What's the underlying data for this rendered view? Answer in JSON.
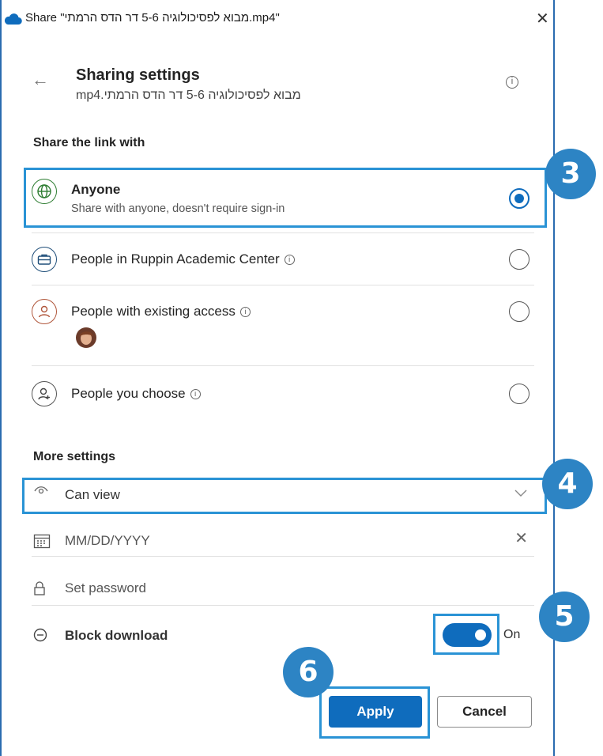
{
  "window": {
    "title": "Share \"מבוא לפסיכולוגיה 5-6 דר הדס הרמתי.mp4\"",
    "close_glyph": "✕",
    "app_icon": "onedrive-cloud-icon"
  },
  "header": {
    "back_glyph": "←",
    "title": "Sharing settings",
    "subtitle": "מבוא לפסיכולוגיה 5-6 דר הדס הרמתי.mp4",
    "info_glyph": "i"
  },
  "share_with": {
    "label": "Share the link with",
    "options": [
      {
        "label": "Anyone",
        "description": "Share with anyone, doesn't require sign-in",
        "icon": "globe-icon",
        "selected": true
      },
      {
        "label": "People in Ruppin Academic Center",
        "icon": "briefcase-icon",
        "selected": false,
        "info": "i"
      },
      {
        "label": "People with existing access",
        "icon": "person-icon",
        "selected": false,
        "info": "i"
      },
      {
        "label": "People you choose",
        "icon": "person-add-icon",
        "selected": false,
        "info": "i"
      }
    ]
  },
  "more_settings": {
    "label": "More settings",
    "permission": {
      "value": "Can view",
      "icon": "eye-icon"
    },
    "expiry": {
      "placeholder": "MM/DD/YYYY",
      "icon": "calendar-icon",
      "clear_glyph": "✕"
    },
    "password": {
      "placeholder": "Set password",
      "icon": "lock-icon"
    },
    "block_download": {
      "label": "Block download",
      "icon": "minus-circle-icon",
      "state_label": "On",
      "enabled": true
    }
  },
  "buttons": {
    "apply": "Apply",
    "cancel": "Cancel"
  },
  "annotations": {
    "badge_3": "3",
    "badge_4": "4",
    "badge_5": "5",
    "badge_6": "6"
  },
  "colors": {
    "accent": "#0f6cbd",
    "highlight": "#2a93d5",
    "badge": "#2d84c4"
  }
}
